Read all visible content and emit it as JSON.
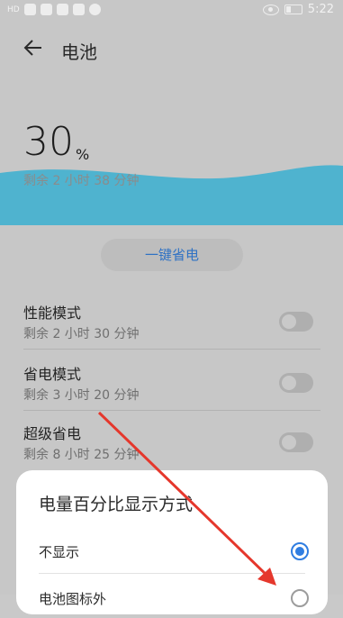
{
  "statusbar": {
    "left_text": "HD",
    "time": "5:22"
  },
  "header": {
    "title": "电池"
  },
  "battery": {
    "percent": "30",
    "unit": "%",
    "remaining": "剩余 2 小时 38 分钟"
  },
  "one_click": {
    "label": "一键省电"
  },
  "modes": [
    {
      "title": "性能模式",
      "subtitle": "剩余 2 小时 30 分钟",
      "enabled": false
    },
    {
      "title": "省电模式",
      "subtitle": "剩余 3 小时 20 分钟",
      "enabled": false
    },
    {
      "title": "超级省电",
      "subtitle": "剩余 8 小时 25 分钟",
      "enabled": false
    }
  ],
  "sheet": {
    "title": "电量百分比显示方式",
    "options": [
      {
        "label": "不显示",
        "selected": true
      },
      {
        "label": "电池图标外",
        "selected": false
      }
    ]
  },
  "colors": {
    "accent": "#2f7de1",
    "wave": "#4fb3cf",
    "annotation_arrow": "#e5372c"
  }
}
